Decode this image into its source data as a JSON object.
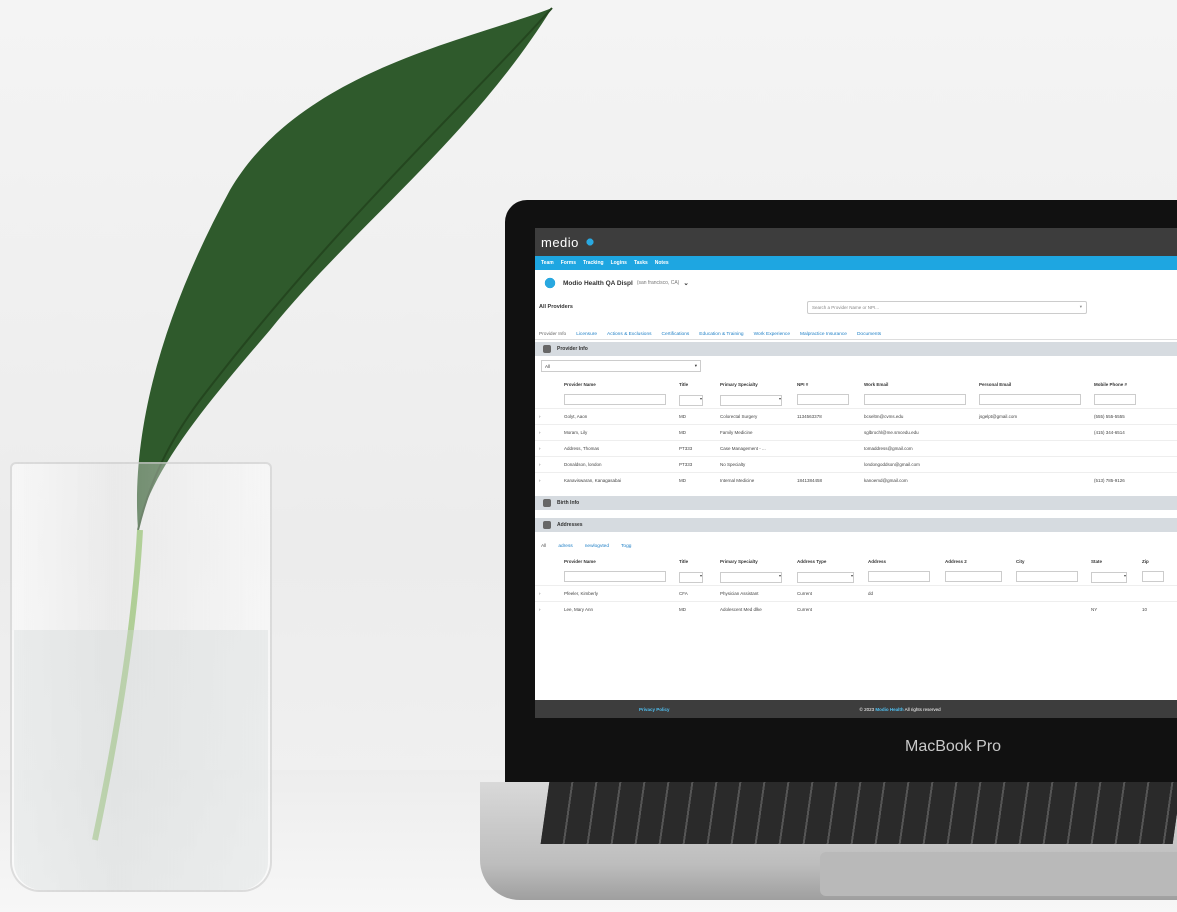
{
  "app": {
    "logo_text": "medio",
    "nav": [
      "Team",
      "Forms",
      "Tracking",
      "Logins",
      "Tasks",
      "Notes"
    ],
    "org_name": "Modio Health QA Displ",
    "org_location": "(san francisco, CA)",
    "org_chevron": "⌄",
    "page_title": "All Providers",
    "search_placeholder": "Search a Provider Name or NPI...",
    "tabs": [
      "Provider Info",
      "Licensure",
      "Actions & Exclusions",
      "Certifications",
      "Education & Training",
      "Work Experience",
      "Malpractice Insurance",
      "Documents"
    ],
    "provider_section": "Provider Info",
    "filter_value": "All",
    "provider_table": {
      "columns": [
        "Provider Name",
        "Title",
        "Primary Specialty",
        "NPI #",
        "Work Email",
        "Personal Email",
        "Mobile Phone #"
      ],
      "rows": [
        [
          "Golyt, Aaon",
          "MD",
          "Colorectal Surgery",
          "1134563378",
          "bcseltm@cvms.edu",
          "jsgelpt@gmail.com",
          "(555) 555-5555"
        ],
        [
          "Moram, Lily",
          "MD",
          "Family Medicine",
          "",
          "sglbrochl@me.smcedu.edu",
          "",
          "(415) 344-6514"
        ],
        [
          "Address, Thomas",
          "PT333",
          "Case Management - ...",
          "",
          "tomaddress@gmail.com",
          "",
          ""
        ],
        [
          "Donaldson, london",
          "PT333",
          "No Specialty",
          "",
          "londongoddson@gmail.com",
          "",
          ""
        ],
        [
          "Kanaviswaran, Kanagasabai",
          "MD",
          "Internal Medicine",
          "1841384458",
          "kanoemd@gmail.com",
          "",
          "(513) 785-9126"
        ]
      ]
    },
    "birth_section": "Birth Info",
    "addresses_section": "Addresses",
    "address_subtabs": [
      "All",
      "adress",
      "newlogvted",
      "Togg"
    ],
    "address_table": {
      "columns": [
        "Provider Name",
        "Title",
        "Primary Specialty",
        "Address Type",
        "Address",
        "Address 2",
        "City",
        "State",
        "Zip"
      ],
      "rows": [
        [
          "Pfeeler, Kimberly",
          "CFA",
          "Physician Assistant",
          "Current",
          "dd",
          "",
          "",
          "",
          ""
        ],
        [
          "Lee, Mary Ann",
          "MD",
          "Adolescent Med dlke",
          "Current",
          "",
          "",
          "",
          "NY",
          "10"
        ]
      ]
    },
    "footer_privacy": "Privacy Policy",
    "footer_copyright_prefix": "© 2023",
    "footer_brand": "Modio Health",
    "footer_rights": "All rights reserved"
  },
  "device_label": "MacBook Pro",
  "colors": {
    "nav_blue": "#1ea6e1",
    "topbar": "#3d3d3d",
    "link_blue": "#1e7fc6"
  }
}
